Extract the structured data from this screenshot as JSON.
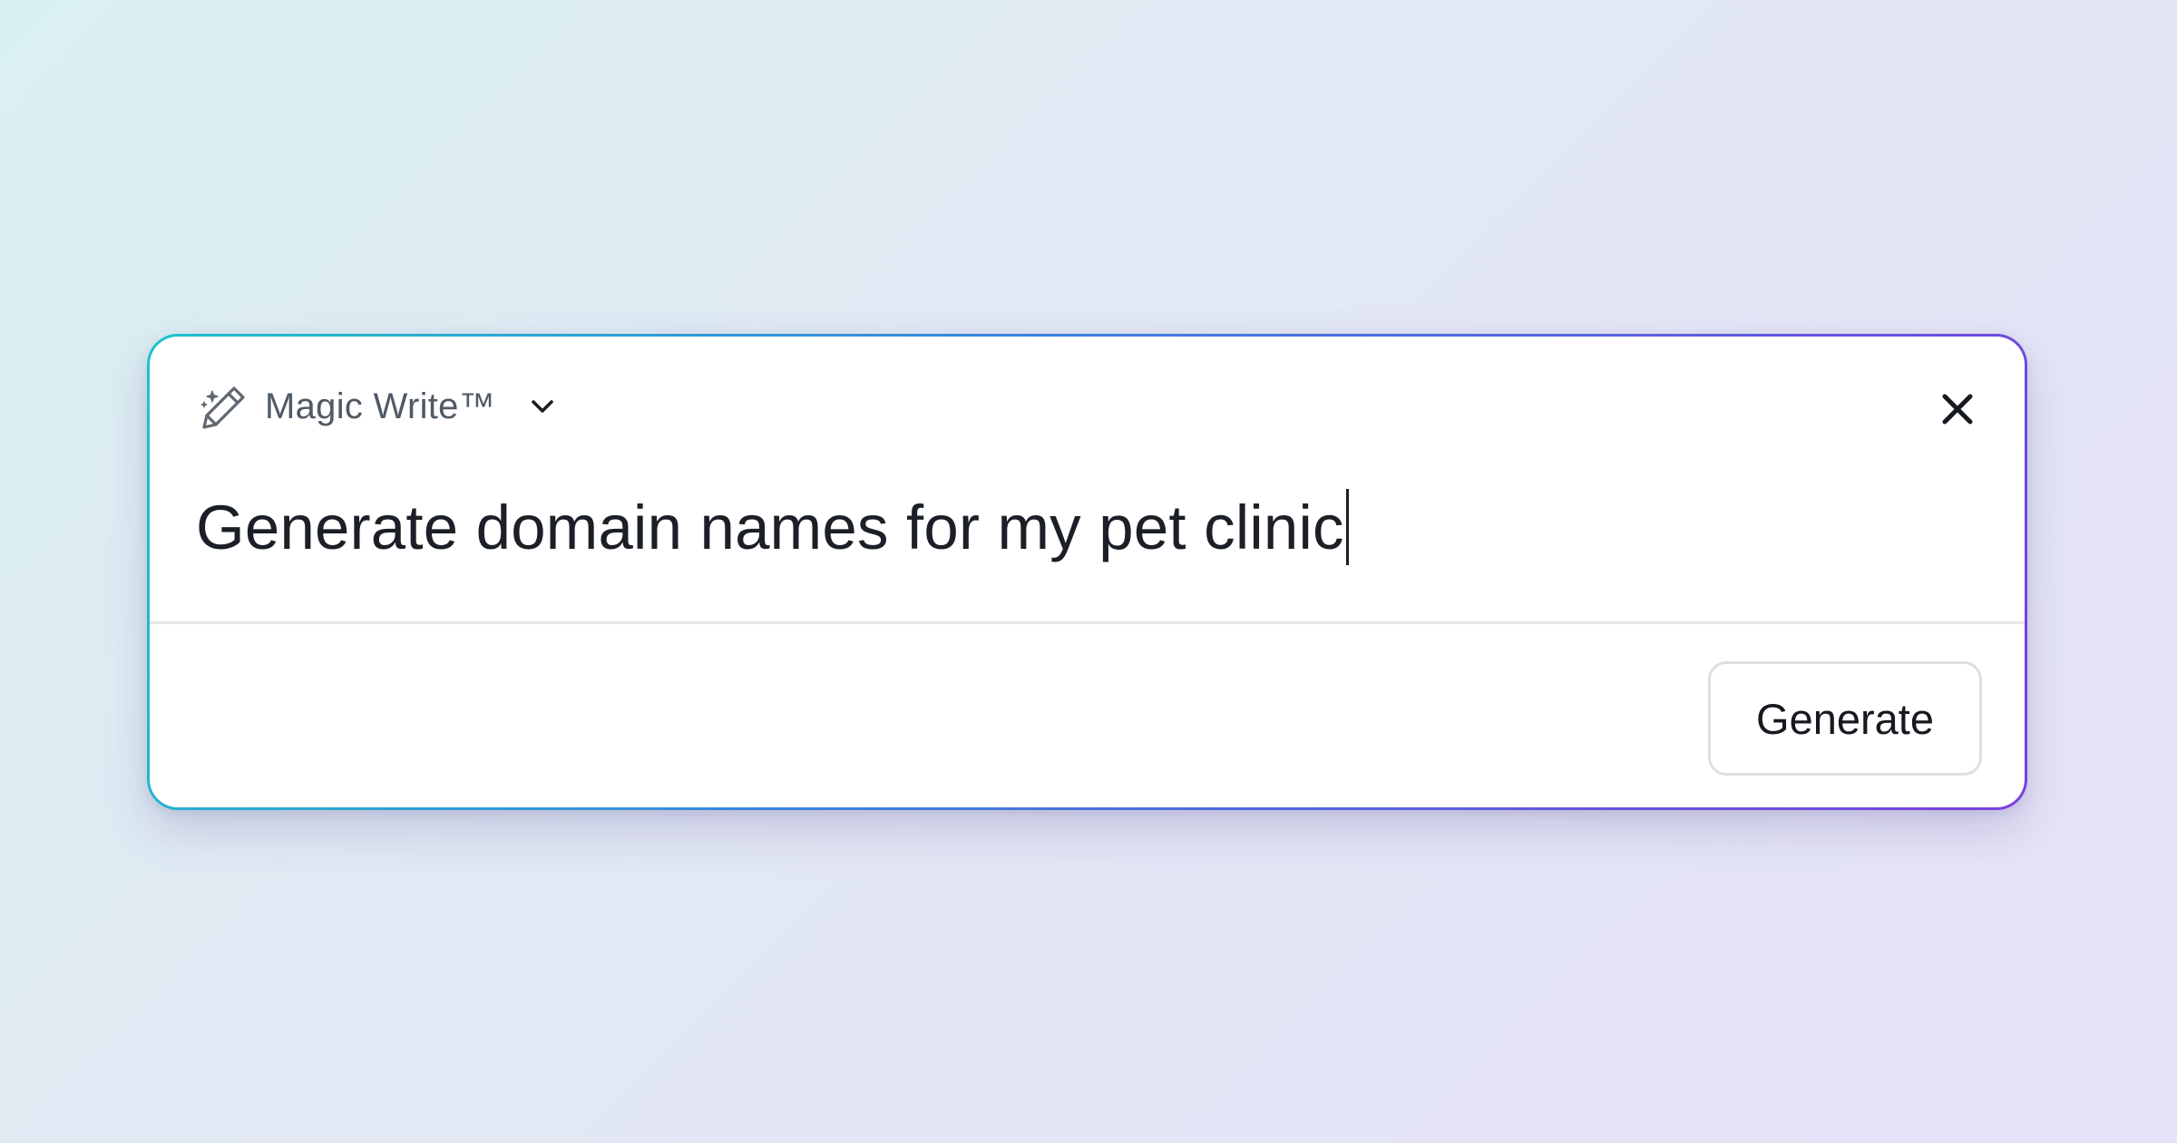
{
  "header": {
    "mode_icon": "magic-pencil-sparkle-icon",
    "mode_label": "Magic Write™",
    "dropdown_icon": "chevron-down-icon",
    "close_icon": "close-icon"
  },
  "prompt": {
    "value": "Generate domain names for my pet clinic"
  },
  "actions": {
    "generate_label": "Generate"
  },
  "colors": {
    "border_gradient": [
      "#1ec2cc",
      "#3d7ee0",
      "#7a3ee0"
    ],
    "text": "#1b1f26",
    "label": "#505a66"
  }
}
